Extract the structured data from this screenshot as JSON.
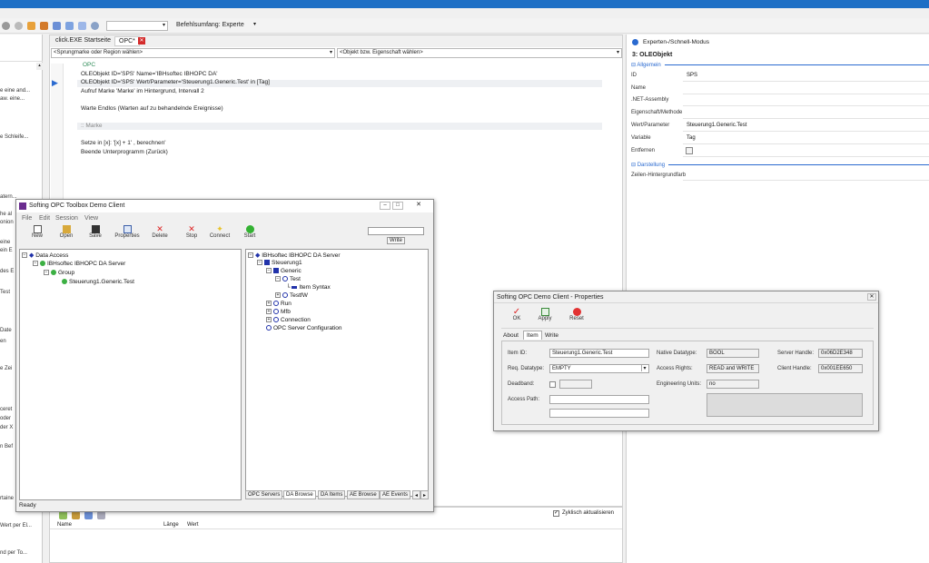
{
  "toolbar": {
    "scope_label": "Befehlsumfang: Experte"
  },
  "left_pane": {
    "snippets": [
      "e eine and...",
      "aw. eine...",
      "e Schleife...",
      "atern...",
      "he al",
      "onion",
      "eine",
      "ein E",
      "des E",
      "Test",
      "Date",
      "en",
      "e Zei",
      "ceret",
      "oder",
      "der X",
      "n Bef",
      "rtaine",
      "Wert per El...",
      "nd per To..."
    ]
  },
  "editor": {
    "tabs": [
      "click.EXE Startseite",
      "OPC*"
    ],
    "jump_placeholder": "<Sprungmarke oder Region wählen>",
    "object_placeholder": "<Objekt bzw. Eigenschaft wählen>",
    "code_lines": [
      "OPC",
      "OLEObjekt ID='SPS' Name='IBHsoftec IBHOPC DA'",
      "OLEObjekt ID='SPS' Wert/Parameter='Steuerung1.Generic.Test' in [Tag]",
      "Aufruf Marke 'Marke' im Hintergrund, Intervall 2",
      "",
      "Warte Endlos (Warten auf zu behandelnde Ereignisse)",
      "",
      ":: Marke",
      "",
      "Setze in [x]: '[x] + 1' , berechnen'",
      "Beende Unterprogramm (Zurück)"
    ]
  },
  "bottom_panel": {
    "refresh_label": "Zyklisch aktualisieren",
    "columns": [
      "Name",
      "Länge",
      "Wert"
    ]
  },
  "right_pane": {
    "title": "Experten-/Schnell-Modus",
    "object": "3: OLEObjekt",
    "section_general": "Allgemein",
    "section_display": "Darstellung",
    "props": [
      {
        "label": "ID",
        "value": "SPS"
      },
      {
        "label": "Name",
        "value": ""
      },
      {
        "label": ".NET-Assembly",
        "value": ""
      },
      {
        "label": "Eigenschaft/Methode",
        "value": ""
      },
      {
        "label": "Wert/Parameter",
        "value": "Steuerung1.Generic.Test"
      },
      {
        "label": "Variable",
        "value": "Tag"
      },
      {
        "label": "Entfernen",
        "value": ""
      }
    ],
    "display_prop": "Zeilen-Hintergrundfarb"
  },
  "opc_window": {
    "title": "Softing OPC Toolbox Demo Client",
    "menu": [
      "File",
      "Edit",
      "Session",
      "View"
    ],
    "buttons": [
      "New",
      "Open",
      "Save",
      "Properties",
      "Delete",
      "Stop",
      "Connect",
      "Start"
    ],
    "write_label": "Write",
    "left_tree": [
      "Data Access",
      "IBHsoftec IBHOPC DA Server",
      "Group",
      "Steuerung1.Generic.Test"
    ],
    "right_tree": [
      "IBHsoftec IBHOPC DA Server",
      "Steuerung1",
      "Generic",
      "Test",
      "Item Syntax",
      "TestfW",
      "Run",
      "Mfb",
      "Connection",
      "OPC Server Configuration"
    ],
    "bottom_tabs": [
      "OPC Servers",
      "DA Browse",
      "DA Items",
      "AE Browse",
      "AE Events"
    ],
    "status": "Ready"
  },
  "props_window": {
    "title": "Softing OPC Demo Client - Properties",
    "buttons": [
      "OK",
      "Apply",
      "Reset"
    ],
    "tabs": [
      "About",
      "Item",
      "Write"
    ],
    "item_id_label": "Item ID:",
    "item_id": "Steuerung1.Generic.Test",
    "req_datatype_label": "Req. Datatype:",
    "req_datatype": "EMPTY",
    "deadband_label": "Deadband:",
    "access_path_label": "Access Path:",
    "native_datatype_label": "Native Datatype:",
    "native_datatype": "BOOL",
    "access_rights_label": "Access Rights:",
    "access_rights": "READ and WRITE",
    "eng_units_label": "Engineering Units:",
    "eng_units": "no",
    "server_handle_label": "Server Handle:",
    "server_handle": "0x06D2E348",
    "client_handle_label": "Client Handle:",
    "client_handle": "0x001EE650"
  }
}
